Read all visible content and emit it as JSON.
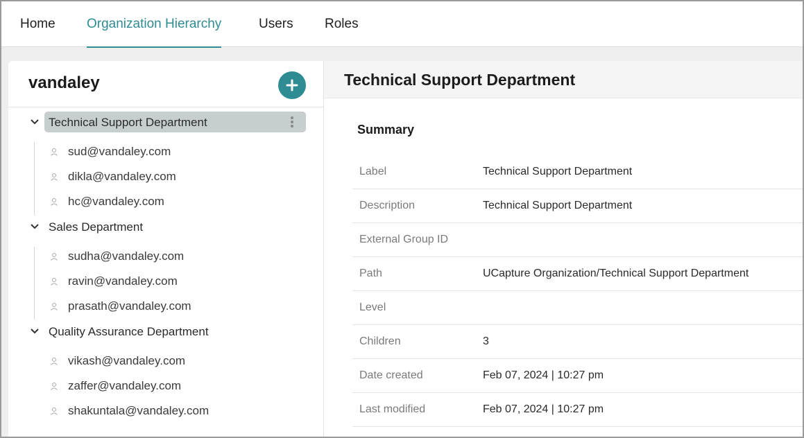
{
  "nav": {
    "tabs": [
      {
        "label": "Home"
      },
      {
        "label": "Organization Hierarchy"
      },
      {
        "label": "Users"
      },
      {
        "label": "Roles"
      }
    ],
    "active_tab": "Organization Hierarchy"
  },
  "sidebar": {
    "org_name": "vandaley",
    "add_button_icon": "plus-icon",
    "departments": [
      {
        "label": "Technical Support Department",
        "selected": true,
        "users": [
          "sud@vandaley.com",
          "dikla@vandaley.com",
          "hc@vandaley.com"
        ]
      },
      {
        "label": "Sales Department",
        "selected": false,
        "users": [
          "sudha@vandaley.com",
          "ravin@vandaley.com",
          "prasath@vandaley.com"
        ]
      },
      {
        "label": "Quality Assurance Department",
        "selected": false,
        "users": [
          "vikash@vandaley.com",
          "zaffer@vandaley.com",
          "shakuntala@vandaley.com"
        ]
      }
    ]
  },
  "detail": {
    "title": "Technical Support Department",
    "summary_heading": "Summary",
    "fields": [
      {
        "key": "Label",
        "value": "Technical Support Department"
      },
      {
        "key": "Description",
        "value": "Technical Support Department"
      },
      {
        "key": "External Group ID",
        "value": ""
      },
      {
        "key": "Path",
        "value": "UCapture Organization/Technical Support Department"
      },
      {
        "key": "Level",
        "value": ""
      },
      {
        "key": "Children",
        "value": "3"
      },
      {
        "key": "Date created",
        "value": "Feb 07, 2024 | 10:27 pm"
      },
      {
        "key": "Last modified",
        "value": "Feb 07, 2024 | 10:27 pm"
      }
    ]
  },
  "colors": {
    "accent": "#2f8c93",
    "selected_row": "#c7cece"
  }
}
